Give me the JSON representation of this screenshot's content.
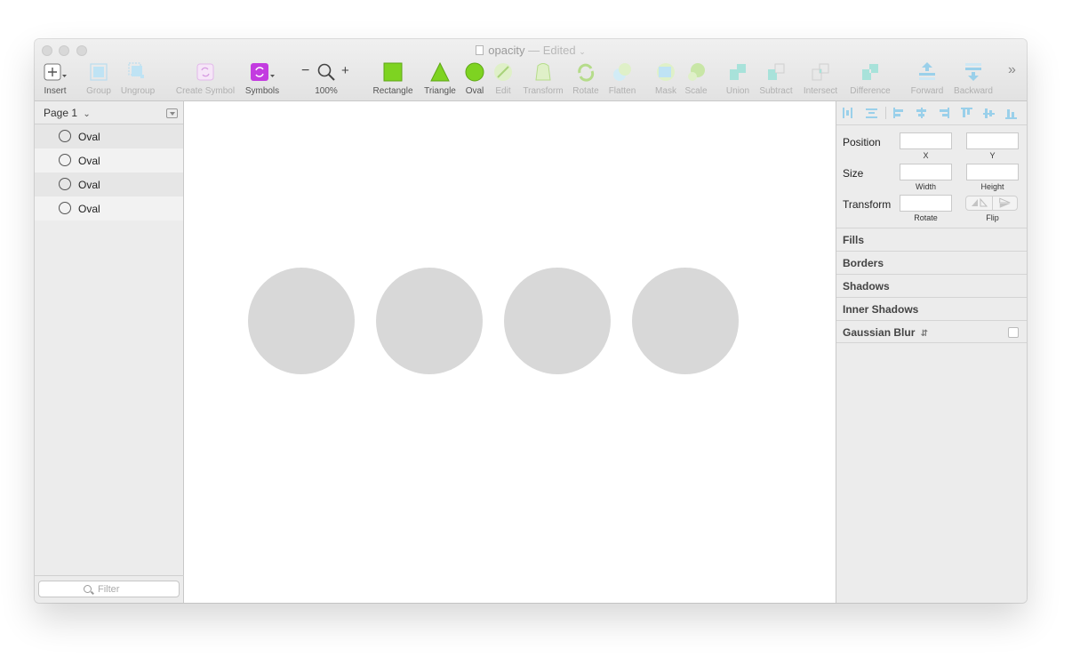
{
  "window": {
    "title": "opacity",
    "edited_suffix": " — Edited"
  },
  "toolbar": {
    "insert": "Insert",
    "group": "Group",
    "ungroup": "Ungroup",
    "create_symbol": "Create Symbol",
    "symbols": "Symbols",
    "zoom_level": "100%",
    "zoom_minus": "−",
    "zoom_plus": "+",
    "rectangle": "Rectangle",
    "triangle": "Triangle",
    "oval": "Oval",
    "edit": "Edit",
    "transform": "Transform",
    "rotate": "Rotate",
    "flatten": "Flatten",
    "mask": "Mask",
    "scale": "Scale",
    "union": "Union",
    "subtract": "Subtract",
    "intersect": "Intersect",
    "difference": "Difference",
    "forward": "Forward",
    "backward": "Backward",
    "overflow": "»"
  },
  "sidebar": {
    "page_label": "Page 1",
    "layers": [
      {
        "name": "Oval"
      },
      {
        "name": "Oval"
      },
      {
        "name": "Oval"
      },
      {
        "name": "Oval"
      }
    ],
    "filter_placeholder": "Filter"
  },
  "inspector": {
    "position_label": "Position",
    "x_label": "X",
    "y_label": "Y",
    "size_label": "Size",
    "width_label": "Width",
    "height_label": "Height",
    "transform_label": "Transform",
    "rotate_label": "Rotate",
    "flip_label": "Flip",
    "sections": {
      "fills": "Fills",
      "borders": "Borders",
      "shadows": "Shadows",
      "inner_shadows": "Inner Shadows",
      "gaussian_blur": "Gaussian Blur"
    }
  },
  "colors": {
    "oval_fill": "#d8d8d8",
    "shape_green": "#7ed321",
    "symbols_purple": "#c33be0",
    "align_blue": "#9ad0ea"
  }
}
